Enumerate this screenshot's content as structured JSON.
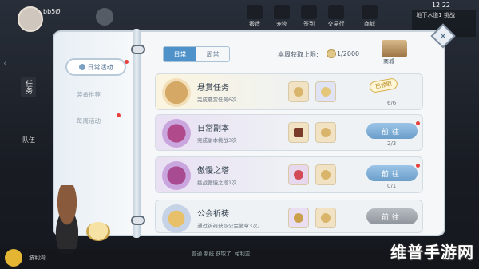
{
  "hud": {
    "player_name": "bb5Ø",
    "menus": [
      "锻造",
      "宠物",
      "签到",
      "交易行",
      "商城"
    ],
    "time": "12:22",
    "right_text": "地下水道1 挑战"
  },
  "side": {
    "tab_task": "任务",
    "team_label": "队伍"
  },
  "book": {
    "menu": {
      "active": "日常活动",
      "items": [
        "装备推荐",
        "每周活动"
      ]
    },
    "tabs": [
      "日常",
      "周常"
    ],
    "weekly_limit_label": "本周获取上限:",
    "weekly_limit_value": "1/2000",
    "shop_label": "商城",
    "close_label": "✕"
  },
  "tasks": [
    {
      "title": "悬赏任务",
      "desc": "完成悬赏任务6次",
      "progress": "6/6",
      "status": "已领取",
      "button": ""
    },
    {
      "title": "日常副本",
      "desc": "完成副本挑战3次",
      "progress": "2/3",
      "status": "",
      "button": "前往"
    },
    {
      "title": "傲慢之塔",
      "desc": "挑战傲慢之塔1次",
      "progress": "0/1",
      "status": "",
      "button": "前往"
    },
    {
      "title": "公会祈祷",
      "desc": "通过祈祷获取公会徽章3次。",
      "progress": "",
      "status": "",
      "button": "前往"
    }
  ],
  "bottom": {
    "left_label": "波利湾",
    "center_text": "普通 系统 获取了: 帕利亚"
  },
  "watermark": "维普手游网",
  "colors": {
    "tab_active": "#4e92c9",
    "button_blue": "#6a9ec9",
    "button_gray": "#8f959c",
    "red_dot": "#e7403b"
  }
}
